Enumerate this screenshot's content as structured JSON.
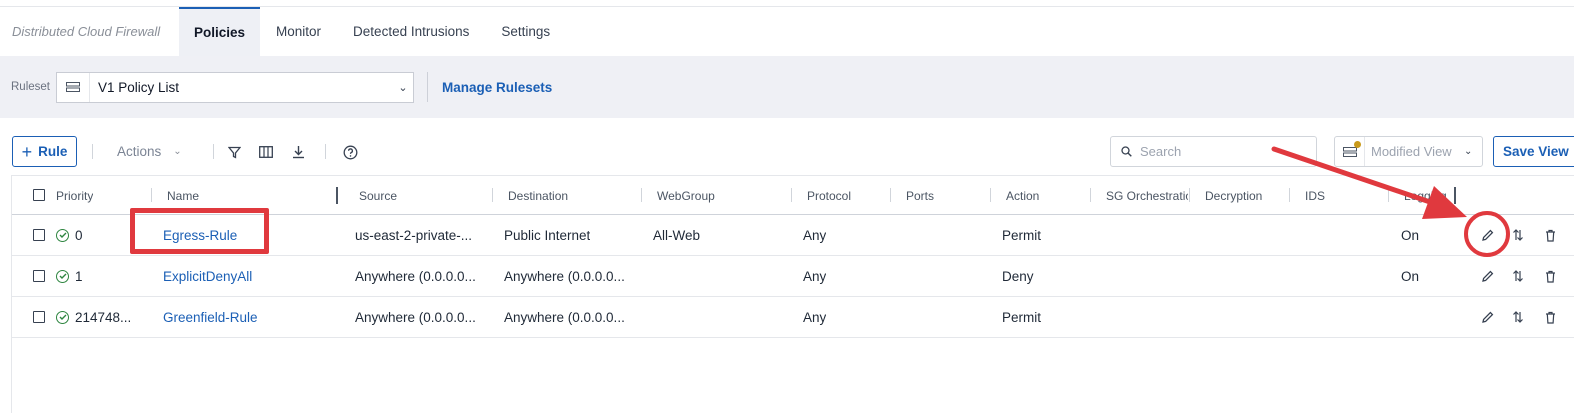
{
  "nav": {
    "app_title": "Distributed Cloud Firewall",
    "tabs": [
      {
        "label": "Policies",
        "active": true
      },
      {
        "label": "Monitor",
        "active": false
      },
      {
        "label": "Detected Intrusions",
        "active": false
      },
      {
        "label": "Settings",
        "active": false
      }
    ]
  },
  "ruleset": {
    "label": "Ruleset",
    "selected": "V1 Policy List",
    "manage_link": "Manage Rulesets"
  },
  "toolbar": {
    "add_rule_label": "Rule",
    "actions_label": "Actions",
    "search_placeholder": "Search",
    "view_selected": "Modified View",
    "save_view_label": "Save View",
    "icons": [
      "filter-icon",
      "columns-icon",
      "download-icon",
      "help-icon"
    ]
  },
  "table": {
    "headers": {
      "priority": "Priority",
      "name": "Name",
      "source": "Source",
      "destination": "Destination",
      "webgroup": "WebGroup",
      "protocol": "Protocol",
      "ports": "Ports",
      "action": "Action",
      "sg_orchestration": "SG Orchestration",
      "decryption": "Decryption",
      "ids": "IDS",
      "logging": "Logging"
    },
    "rows": [
      {
        "priority": "0",
        "name": "Egress-Rule",
        "source": "us-east-2-private-...",
        "destination": "Public Internet",
        "webgroup": "All-Web",
        "protocol": "Any",
        "ports": "",
        "action": "Permit",
        "logging": "On"
      },
      {
        "priority": "1",
        "name": "ExplicitDenyAll",
        "source": "Anywhere (0.0.0.0...",
        "destination": "Anywhere (0.0.0.0...",
        "webgroup": "",
        "protocol": "Any",
        "ports": "",
        "action": "Deny",
        "logging": "On"
      },
      {
        "priority": "214748...",
        "name": "Greenfield-Rule",
        "source": "Anywhere (0.0.0.0...",
        "destination": "Anywhere (0.0.0.0...",
        "webgroup": "",
        "protocol": "Any",
        "ports": "",
        "action": "Permit",
        "logging": ""
      }
    ]
  },
  "colors": {
    "accent": "#1b5fb5",
    "status_ok": "#2e8540",
    "annotation": "#e0393e"
  }
}
